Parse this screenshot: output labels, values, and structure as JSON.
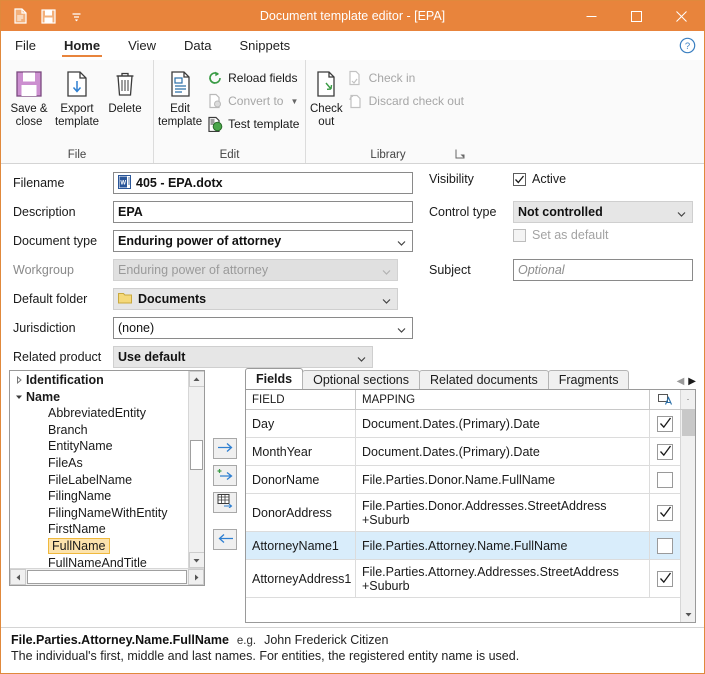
{
  "window": {
    "title": "Document template editor - [EPA]",
    "titlebar_color": "#e8843c",
    "accent_color": "#e8843c",
    "quick_access": [
      {
        "name": "new-document-icon",
        "label": "New"
      },
      {
        "name": "save-icon",
        "label": "Save"
      },
      {
        "name": "customize-quick-access-icon",
        "label": "Customize Quick Access Toolbar"
      }
    ],
    "controls": {
      "minimize": "–",
      "maximize": "□",
      "close": "✕"
    }
  },
  "menu": {
    "tabs": [
      {
        "label": "File",
        "active": false
      },
      {
        "label": "Home",
        "active": true
      },
      {
        "label": "View",
        "active": false
      },
      {
        "label": "Data",
        "active": false
      },
      {
        "label": "Snippets",
        "active": false
      }
    ],
    "help_label": "?"
  },
  "ribbon": {
    "groups": [
      {
        "label": "File",
        "big_buttons": [
          {
            "label": "Save &\nclose",
            "icon": "save-icon",
            "enabled": true
          },
          {
            "label": "Export\ntemplate",
            "icon": "export-icon",
            "enabled": true
          },
          {
            "label": "Delete",
            "icon": "trash-icon",
            "enabled": true
          }
        ],
        "small_buttons": []
      },
      {
        "label": "Edit",
        "big_buttons": [
          {
            "label": "Edit\ntemplate",
            "icon": "edit-document-icon",
            "enabled": true
          }
        ],
        "small_buttons": [
          {
            "label": "Reload fields",
            "icon": "refresh-icon",
            "enabled": true,
            "has_caret": false
          },
          {
            "label": "Convert to",
            "icon": "convert-icon",
            "enabled": false,
            "has_caret": true
          },
          {
            "label": "Test template",
            "icon": "test-template-icon",
            "enabled": true,
            "has_caret": false
          }
        ]
      },
      {
        "label": "Library",
        "big_buttons": [
          {
            "label": "Check\nout",
            "icon": "check-out-icon",
            "enabled": true
          }
        ],
        "small_buttons": [
          {
            "label": "Check in",
            "icon": "check-in-icon",
            "enabled": false,
            "has_caret": false
          },
          {
            "label": "Discard check out",
            "icon": "discard-check-out-icon",
            "enabled": false,
            "has_caret": false
          }
        ],
        "dialog_launcher": true
      }
    ]
  },
  "form": {
    "left": [
      {
        "label": "Filename",
        "value": "405 - EPA.dotx",
        "type": "text",
        "icon": "word-document-icon",
        "enabled": true
      },
      {
        "label": "Description",
        "value": "EPA",
        "type": "text",
        "enabled": true
      },
      {
        "label": "Document type",
        "value": "Enduring power of attorney",
        "type": "combo-white",
        "enabled": true
      },
      {
        "label": "Workgroup",
        "value": "Enduring power of attorney",
        "type": "combo",
        "enabled": false
      },
      {
        "label": "Default folder",
        "value": "Documents",
        "type": "combo",
        "icon": "folder-icon",
        "enabled": true
      },
      {
        "label": "Jurisdiction",
        "value": "(none)",
        "type": "combo-white",
        "enabled": true
      },
      {
        "label": "Related product",
        "value": "Use default",
        "type": "combo",
        "enabled": true
      }
    ],
    "right": {
      "visibility_label": "Visibility",
      "visibility_checkbox": {
        "label": "Active",
        "checked": true,
        "enabled": true
      },
      "control_type_label": "Control type",
      "control_type_value": "Not controlled",
      "set_as_default": {
        "label": "Set as default",
        "checked": false,
        "enabled": false
      },
      "subject_label": "Subject",
      "subject_value": "",
      "subject_placeholder": "Optional"
    }
  },
  "tree": {
    "items": [
      {
        "label": "Identification",
        "group": true,
        "expanded": false,
        "selected": false
      },
      {
        "label": "Name",
        "group": true,
        "expanded": true,
        "selected": false
      },
      {
        "label": "AbbreviatedEntity",
        "group": false,
        "selected": false
      },
      {
        "label": "Branch",
        "group": false,
        "selected": false
      },
      {
        "label": "EntityName",
        "group": false,
        "selected": false
      },
      {
        "label": "FileAs",
        "group": false,
        "selected": false
      },
      {
        "label": "FileLabelName",
        "group": false,
        "selected": false
      },
      {
        "label": "FilingName",
        "group": false,
        "selected": false
      },
      {
        "label": "FilingNameWithEntity",
        "group": false,
        "selected": false
      },
      {
        "label": "FirstName",
        "group": false,
        "selected": false
      },
      {
        "label": "FullName",
        "group": false,
        "selected": true
      },
      {
        "label": "FullNameAndTitle",
        "group": false,
        "selected": false
      }
    ]
  },
  "transfer_buttons": [
    {
      "name": "insert-field-button",
      "icon": "arrow-right-icon"
    },
    {
      "name": "add-field-button",
      "icon": "arrow-right-plus-icon"
    },
    {
      "name": "insert-table-button",
      "icon": "table-arrow-icon"
    },
    {
      "name": "remove-field-button",
      "icon": "arrow-left-icon"
    }
  ],
  "panel": {
    "tabs": [
      {
        "label": "Fields",
        "active": true
      },
      {
        "label": "Optional sections",
        "active": false
      },
      {
        "label": "Related documents",
        "active": false
      },
      {
        "label": "Fragments",
        "active": false
      }
    ],
    "tab_nav": {
      "prev": "◀",
      "next": "▶"
    },
    "grid": {
      "columns": [
        "FIELD",
        "MAPPING"
      ],
      "check_column_icon": "field-options-icon",
      "rows": [
        {
          "field": "Day",
          "mapping": "Document.Dates.(Primary).Date",
          "checked": true,
          "selected": false,
          "tall": false
        },
        {
          "field": "MonthYear",
          "mapping": "Document.Dates.(Primary).Date",
          "checked": true,
          "selected": false,
          "tall": false
        },
        {
          "field": "DonorName",
          "mapping": "File.Parties.Donor.Name.FullName",
          "checked": false,
          "selected": false,
          "tall": false
        },
        {
          "field": "DonorAddress",
          "mapping": "File.Parties.Donor.Addresses.StreetAddress\n+Suburb",
          "checked": true,
          "selected": false,
          "tall": true
        },
        {
          "field": "AttorneyName1",
          "mapping": "File.Parties.Attorney.Name.FullName",
          "checked": false,
          "selected": true,
          "tall": false
        },
        {
          "field": "AttorneyAddress1",
          "mapping": "File.Parties.Attorney.Addresses.StreetAddress\n+Suburb",
          "checked": true,
          "selected": false,
          "tall": true
        }
      ]
    }
  },
  "status": {
    "path": "File.Parties.Attorney.Name.FullName",
    "eg_label": "e.g.",
    "example": "John Frederick Citizen",
    "description": "The individual's first, middle and last names. For entities, the registered entity name is used."
  }
}
